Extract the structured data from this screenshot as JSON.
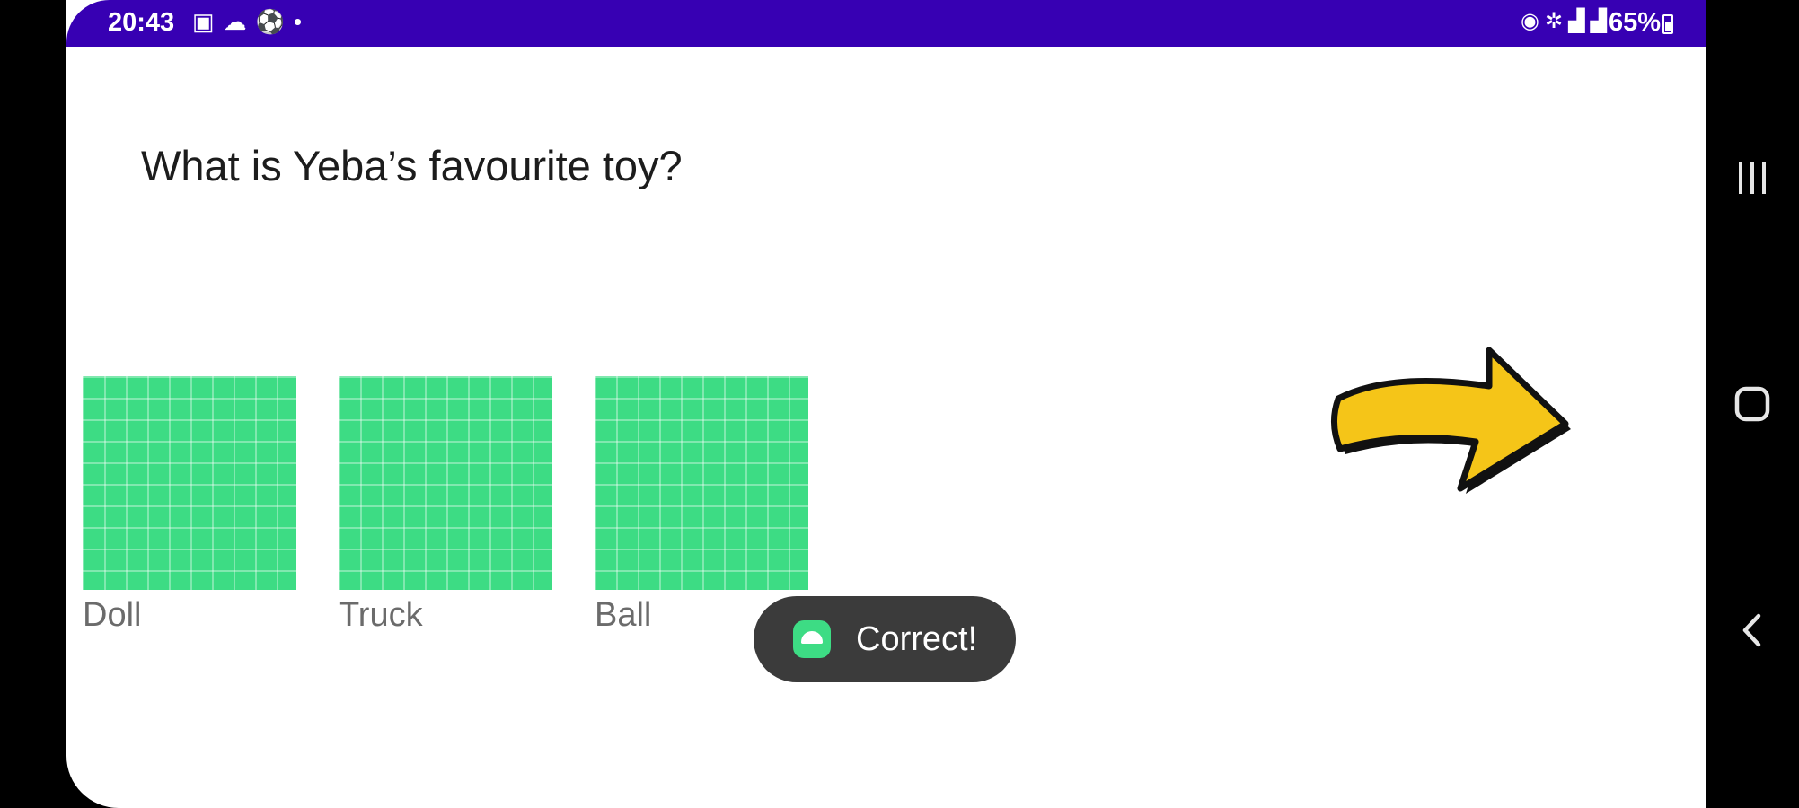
{
  "status_bar": {
    "time": "20:43",
    "left_icons": [
      "gallery-icon",
      "cloud-icon",
      "soccer-ball-icon",
      "dot-icon"
    ],
    "right_icons": [
      "hotspot-icon",
      "wifi-icon",
      "signal-icon",
      "signal-icon"
    ],
    "battery_percent": "65%",
    "color": "#3700b3"
  },
  "question": {
    "text": "What is Yeba’s favourite toy?"
  },
  "options": [
    {
      "label": "Doll",
      "color": "#3ddc84"
    },
    {
      "label": "Truck",
      "color": "#3ddc84"
    },
    {
      "label": "Ball",
      "color": "#3ddc84"
    }
  ],
  "toast": {
    "text": "Correct!",
    "icon": "android-icon"
  },
  "next_arrow": {
    "icon": "arrow-right-icon",
    "color": "#f5c518"
  },
  "nav_bar": {
    "buttons": [
      "recents-icon",
      "home-icon",
      "back-icon"
    ]
  }
}
